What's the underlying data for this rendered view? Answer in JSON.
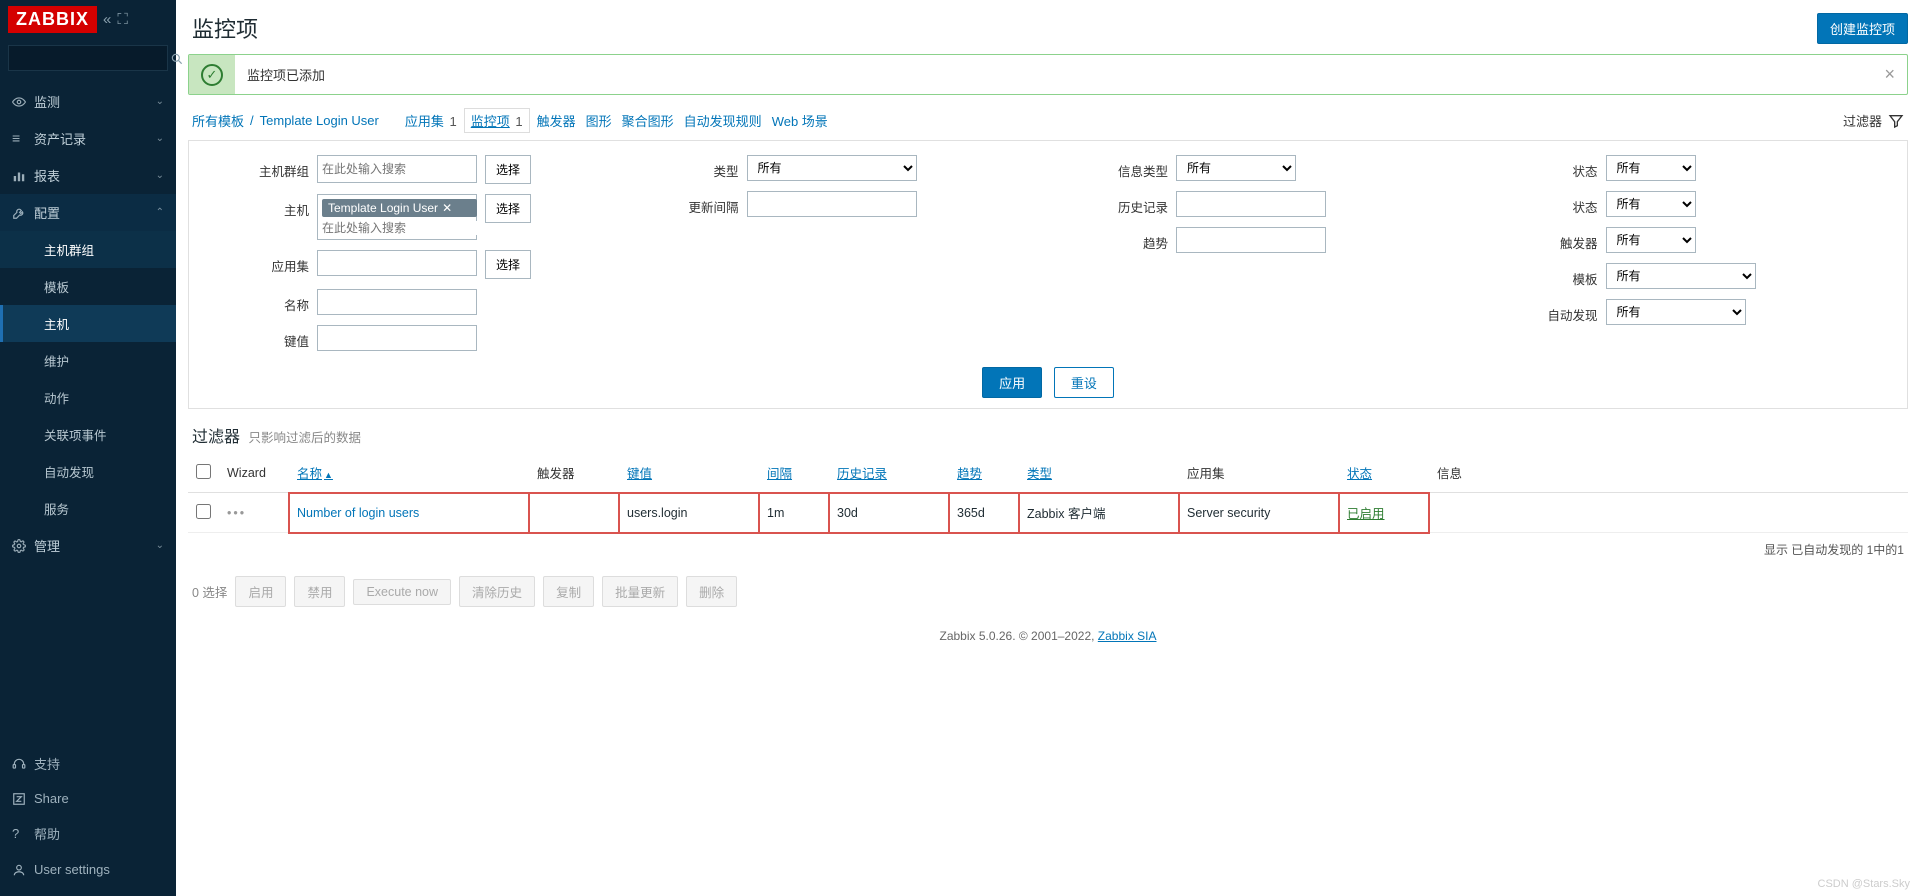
{
  "brand": "ZABBIX",
  "sidebar": {
    "items": [
      {
        "label": "监测",
        "icon": "eye"
      },
      {
        "label": "资产记录",
        "icon": "list"
      },
      {
        "label": "报表",
        "icon": "chart"
      },
      {
        "label": "配置",
        "icon": "wrench",
        "open": true
      },
      {
        "label": "管理",
        "icon": "gear"
      }
    ],
    "config_sub": [
      {
        "label": "主机群组"
      },
      {
        "label": "模板"
      },
      {
        "label": "主机",
        "active": true
      },
      {
        "label": "维护"
      },
      {
        "label": "动作"
      },
      {
        "label": "关联项事件"
      },
      {
        "label": "自动发现"
      },
      {
        "label": "服务"
      }
    ],
    "bottom": [
      {
        "label": "支持",
        "icon": "headset"
      },
      {
        "label": "Share",
        "icon": "square-z"
      },
      {
        "label": "帮助",
        "icon": "question"
      },
      {
        "label": "User settings",
        "icon": "user"
      }
    ]
  },
  "page": {
    "title": "监控项",
    "create_button": "创建监控项"
  },
  "alert": {
    "message": "监控项已添加"
  },
  "breadcrumb": {
    "root": "所有模板",
    "template": "Template Login User",
    "tabs": [
      {
        "label": "应用集",
        "count": "1"
      },
      {
        "label": "监控项",
        "count": "1",
        "active": true
      },
      {
        "label": "触发器"
      },
      {
        "label": "图形"
      },
      {
        "label": "聚合图形"
      },
      {
        "label": "自动发现规则"
      },
      {
        "label": "Web 场景"
      }
    ],
    "filter_label": "过滤器"
  },
  "filter": {
    "labels": {
      "hostgroup": "主机群组",
      "host": "主机",
      "appset": "应用集",
      "name": "名称",
      "key": "键值",
      "type": "类型",
      "update_interval": "更新间隔",
      "info_type": "信息类型",
      "history": "历史记录",
      "trends": "趋势",
      "state": "状态",
      "status": "状态",
      "trigger": "触发器",
      "template": "模板",
      "discovery": "自动发现"
    },
    "placeholder_search": "在此处输入搜索",
    "select_button": "选择",
    "host_tag": "Template Login User",
    "dropdown_all": "所有",
    "apply": "应用",
    "reset": "重设"
  },
  "subfilter": {
    "title": "过滤器",
    "hint": "只影响过滤后的数据"
  },
  "table": {
    "headers": {
      "wizard": "Wizard",
      "name": "名称",
      "trigger": "触发器",
      "key": "键值",
      "interval": "间隔",
      "history": "历史记录",
      "trends": "趋势",
      "type": "类型",
      "appset": "应用集",
      "status": "状态",
      "info": "信息"
    },
    "row": {
      "name": "Number of login users",
      "key": "users.login",
      "interval": "1m",
      "history": "30d",
      "trends": "365d",
      "type": "Zabbix 客户端",
      "appset": "Server security",
      "status": "已启用"
    },
    "footer": "显示 已自动发现的 1中的1"
  },
  "bulk": {
    "selected": "0 选择",
    "buttons": [
      "启用",
      "禁用",
      "Execute now",
      "清除历史",
      "复制",
      "批量更新",
      "删除"
    ]
  },
  "footer": {
    "text": "Zabbix 5.0.26. © 2001–2022, ",
    "link": "Zabbix SIA"
  },
  "watermark": "CSDN @Stars.Sky"
}
